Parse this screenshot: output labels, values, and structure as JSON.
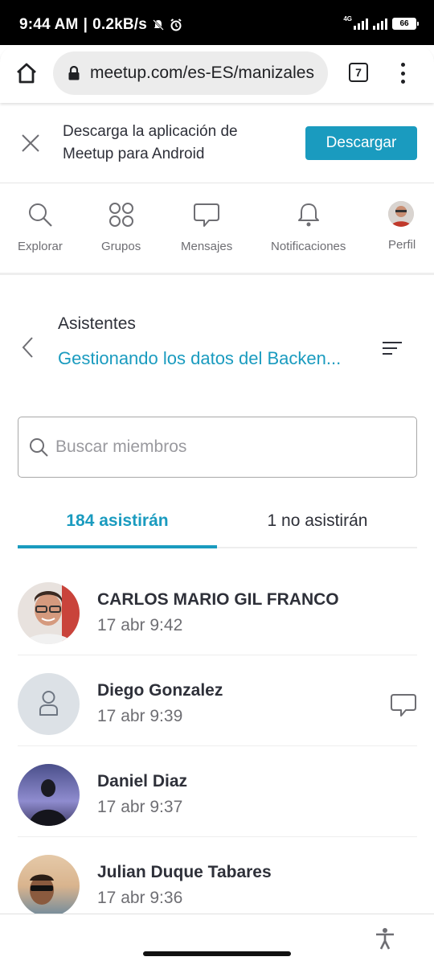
{
  "status_bar": {
    "time": "9:44 AM",
    "separator": "|",
    "speed": "0.2kB/s",
    "network": "4G",
    "battery": "66"
  },
  "browser": {
    "url": "meetup.com/es-ES/manizales",
    "tab_count": "7"
  },
  "app_banner": {
    "text": "Descarga la aplicación de Meetup para Android",
    "button": "Descargar"
  },
  "nav": {
    "items": [
      {
        "label": "Explorar",
        "icon": "search-icon"
      },
      {
        "label": "Grupos",
        "icon": "groups-icon"
      },
      {
        "label": "Mensajes",
        "icon": "message-icon"
      },
      {
        "label": "Notificaciones",
        "icon": "bell-icon"
      },
      {
        "label": "Perfil",
        "icon": "profile-avatar"
      }
    ]
  },
  "section": {
    "label": "Asistentes",
    "event_title": "Gestionando los datos del Backen..."
  },
  "search": {
    "placeholder": "Buscar miembros"
  },
  "tabs": [
    {
      "label": "184 asistirán",
      "active": true
    },
    {
      "label": "1 no asistirán",
      "active": false
    }
  ],
  "attendees": [
    {
      "name": "CARLOS MARIO GIL FRANCO",
      "time": "17 abr 9:42"
    },
    {
      "name": "Diego Gonzalez",
      "time": "17 abr 9:39"
    },
    {
      "name": "Daniel Diaz",
      "time": "17 abr 9:37"
    },
    {
      "name": "Julian Duque Tabares",
      "time": "17 abr 9:36"
    }
  ],
  "colors": {
    "accent": "#1a9bbf",
    "text": "#2e3039",
    "muted": "#6e6e73"
  }
}
